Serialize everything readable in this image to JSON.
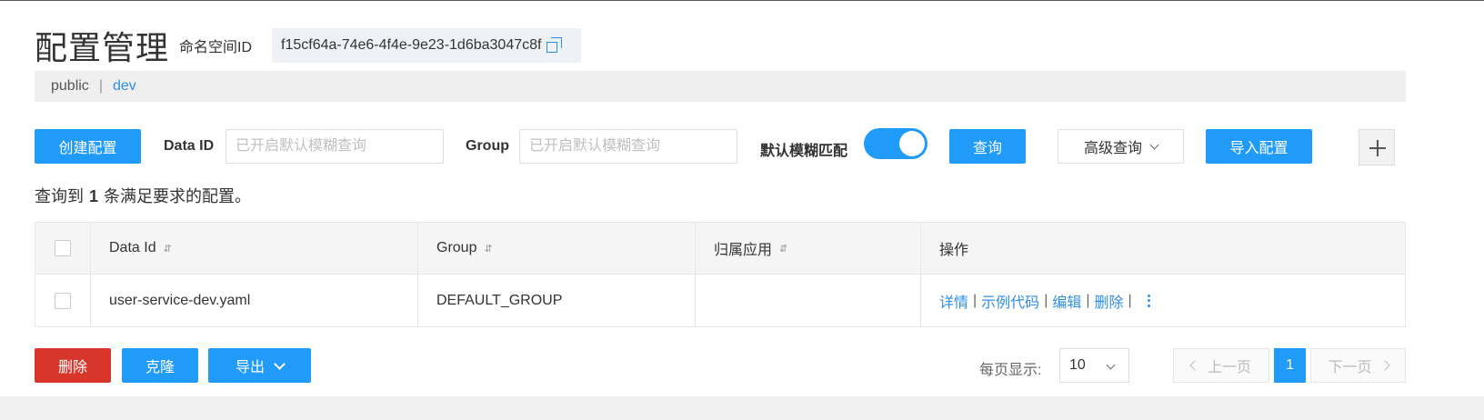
{
  "header": {
    "title": "配置管理",
    "namespace_label": "命名空间ID",
    "namespace_id": "f15cf64a-74e6-4f4e-9e23-1d6ba3047c8f",
    "copy_icon": "copy-icon"
  },
  "namespaces": {
    "items": [
      "public",
      "dev"
    ],
    "separator": "|",
    "active": "dev"
  },
  "toolbar": {
    "create_label": "创建配置",
    "data_id_label": "Data ID",
    "data_id_placeholder": "已开启默认模糊查询",
    "data_id_value": "",
    "group_label": "Group",
    "group_placeholder": "已开启默认模糊查询",
    "group_value": "",
    "fuzzy_label": "默认模糊匹配",
    "fuzzy_on": true,
    "query_label": "查询",
    "advanced_label": "高级查询",
    "import_label": "导入配置",
    "plus_icon": "plus-icon"
  },
  "result": {
    "prefix": "查询到",
    "count": "1",
    "suffix": "条满足要求的配置。"
  },
  "table": {
    "columns": [
      "Data Id",
      "Group",
      "归属应用",
      "操作"
    ],
    "sort_icon": "⇵",
    "rows": [
      {
        "data_id": "user-service-dev.yaml",
        "group": "DEFAULT_GROUP",
        "app": "",
        "actions": [
          "详情",
          "示例代码",
          "编辑",
          "删除"
        ],
        "action_sep": "|"
      }
    ]
  },
  "footer": {
    "delete_label": "删除",
    "clone_label": "克隆",
    "export_label": "导出",
    "page_size_label": "每页显示:",
    "page_size": "10",
    "prev_label": "上一页",
    "current_page": "1",
    "next_label": "下一页"
  },
  "colors": {
    "primary": "#209bfa",
    "danger": "#d9362b",
    "link": "#2f8fe8"
  }
}
